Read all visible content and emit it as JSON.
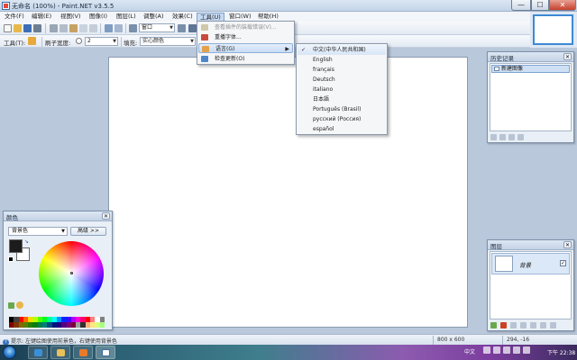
{
  "window": {
    "title": "无命名 (100%) - Paint.NET v3.5.5",
    "min_glyph": "—",
    "max_glyph": "☐",
    "close_glyph": "✕"
  },
  "menubar": {
    "items": [
      "文件(F)",
      "编辑(E)",
      "视图(V)",
      "图像(I)",
      "图层(L)",
      "调整(A)",
      "效果(C)",
      "工具(U)",
      "窗口(W)",
      "帮助(H)"
    ],
    "open_index": 7
  },
  "toolbar1": {
    "zoom_combo": "窗口",
    "colors": {
      "new": "#f1c232",
      "open": "#e6b94a",
      "save": "#3d6fb6",
      "print": "#6d7e93"
    }
  },
  "toolbar2": {
    "tool_label": "工具(T):",
    "brush_width_label": "刷子宽度:",
    "brush_width_value": "2",
    "fill_label": "填充:",
    "fill_value": "实心颜色"
  },
  "tools_menu": {
    "items": [
      {
        "label": "查看插件的装载错误(V)...",
        "disabled": true,
        "icon": "plugin-icon"
      },
      {
        "label": "重播字体...",
        "disabled": false,
        "icon": "font-icon"
      },
      {
        "label": "语言(G)",
        "disabled": false,
        "highlighted": true,
        "has_submenu": true,
        "icon": "language-icon"
      },
      {
        "label": "检查更新(O)",
        "disabled": false,
        "icon": "update-icon"
      }
    ],
    "submenu_arrow": "▶"
  },
  "language_menu": {
    "items": [
      {
        "label": "中文(中华人民共和国)",
        "checked": true
      },
      {
        "label": "English",
        "checked": false
      },
      {
        "label": "français",
        "checked": false
      },
      {
        "label": "Deutsch",
        "checked": false
      },
      {
        "label": "italiano",
        "checked": false
      },
      {
        "label": "日本語",
        "checked": false
      },
      {
        "label": "Português (Brasil)",
        "checked": false
      },
      {
        "label": "русский (Россия)",
        "checked": false
      },
      {
        "label": "español",
        "checked": false
      }
    ],
    "check_glyph": "✓"
  },
  "history_panel": {
    "title": "历史记录",
    "items": [
      "新建图像"
    ],
    "close_glyph": "✕"
  },
  "layers_panel": {
    "title": "图层",
    "layers": [
      {
        "name": "背景",
        "visible": true
      }
    ],
    "close_glyph": "✕",
    "check_glyph": "✓"
  },
  "colors_panel": {
    "title": "颜色",
    "select_value": "背景色",
    "more_button": "高级 >>",
    "primary_color": "#1c1c1c",
    "secondary_color": "#ffffff",
    "close_glyph": "✕",
    "palette": [
      "#000000",
      "#404040",
      "#ff0000",
      "#ff6a00",
      "#ffd800",
      "#b6ff00",
      "#4cff00",
      "#00ff21",
      "#00ff90",
      "#00ffff",
      "#0094ff",
      "#0026ff",
      "#4800ff",
      "#b200ff",
      "#ff00dc",
      "#ff006e",
      "#ff0000",
      "#ff7f7f",
      "#ffffff",
      "#808080",
      "#7f0000",
      "#7f3300",
      "#7f6a00",
      "#5b7f00",
      "#267f00",
      "#007f0e",
      "#007f46",
      "#007f7f",
      "#004a7f",
      "#00137f",
      "#21007f",
      "#57007f",
      "#7f006e",
      "#7f0037",
      "#a0a0a0",
      "#303030",
      "#ffb27f",
      "#ffe97f",
      "#daff7f",
      "#a5ff7f"
    ]
  },
  "statusbar": {
    "help_text": "提示: 左键绘图使用前景色，右键使用背景色",
    "image_size": "800 x 600",
    "cursor_position": "294, -16"
  },
  "taskbar": {
    "tray_lang": "中文",
    "clock": "下午 22:38"
  }
}
